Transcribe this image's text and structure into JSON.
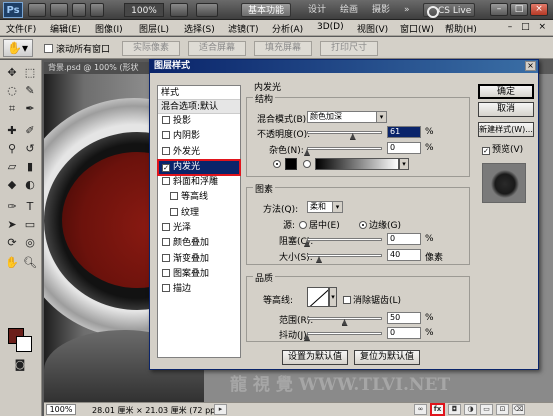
{
  "app": {
    "logo": "Ps",
    "zoom_level": "100%",
    "workspace_tabs": [
      "基本功能",
      "设计",
      "绘画",
      "摄影"
    ],
    "more": "»",
    "cs_live": "CS Live"
  },
  "menu": [
    "文件(F)",
    "编辑(E)",
    "图像(I)",
    "图层(L)",
    "选择(S)",
    "滤镜(T)",
    "分析(A)",
    "3D(D)",
    "视图(V)",
    "窗口(W)",
    "帮助(H)"
  ],
  "options_bar": {
    "scroll_all": "滚动所有窗口",
    "buttons": [
      "实际像素",
      "适合屏幕",
      "填充屏幕",
      "打印尺寸"
    ]
  },
  "document": {
    "tab_title": "背景.psd @ 100% (形状",
    "status_zoom": "100%",
    "status_size": "28.01 厘米 × 21.03 厘米 (72 ppi)"
  },
  "watermark": "龍 視 覺 WWW.TLVI.NET",
  "dialog": {
    "title": "图层样式",
    "close": "×",
    "style_header": "样式",
    "blend_options": "混合选项:默认",
    "styles": [
      {
        "label": "投影",
        "checked": false,
        "sub": false
      },
      {
        "label": "内阴影",
        "checked": false,
        "sub": false
      },
      {
        "label": "外发光",
        "checked": false,
        "sub": false
      },
      {
        "label": "内发光",
        "checked": true,
        "sub": false,
        "selected": true
      },
      {
        "label": "斜面和浮雕",
        "checked": false,
        "sub": false
      },
      {
        "label": "等高线",
        "checked": false,
        "sub": true
      },
      {
        "label": "纹理",
        "checked": false,
        "sub": true
      },
      {
        "label": "光泽",
        "checked": false,
        "sub": false
      },
      {
        "label": "颜色叠加",
        "checked": false,
        "sub": false
      },
      {
        "label": "渐变叠加",
        "checked": false,
        "sub": false
      },
      {
        "label": "图案叠加",
        "checked": false,
        "sub": false
      },
      {
        "label": "描边",
        "checked": false,
        "sub": false
      }
    ],
    "section_title": "内发光",
    "structure": {
      "label": "结构",
      "blend_mode_label": "混合模式(B):",
      "blend_mode_value": "颜色加深",
      "opacity_label": "不透明度(O):",
      "opacity_value": "61",
      "opacity_fraction": 0.61,
      "noise_label": "杂色(N):",
      "noise_value": "0",
      "noise_fraction": 0.0,
      "unit": "%"
    },
    "elements": {
      "label": "图素",
      "technique_label": "方法(Q):",
      "technique_value": "柔和",
      "source_label": "源:",
      "source_center": "居中(E)",
      "source_edge": "边缘(G)",
      "choke_label": "阻塞(C):",
      "choke_value": "0",
      "choke_fraction": 0.0,
      "size_label": "大小(S):",
      "size_value": "40",
      "size_fraction": 0.16,
      "size_unit": "像素",
      "unit": "%"
    },
    "quality": {
      "label": "品质",
      "contour_label": "等高线:",
      "antialias_label": "消除锯齿(L)",
      "range_label": "范围(R):",
      "range_value": "50",
      "range_fraction": 0.5,
      "jitter_label": "抖动(J):",
      "jitter_value": "0",
      "jitter_fraction": 0.0,
      "unit": "%"
    },
    "set_default": "设置为默认值",
    "reset_default": "复位为默认值",
    "ok": "确定",
    "cancel": "取消",
    "new_style": "新建样式(W)...",
    "preview_label": "预览(V)"
  },
  "status_icons": [
    "link-icon",
    "fx-icon",
    "mask-icon",
    "adjustment-icon",
    "group-icon",
    "new-layer-icon",
    "trash-icon"
  ]
}
